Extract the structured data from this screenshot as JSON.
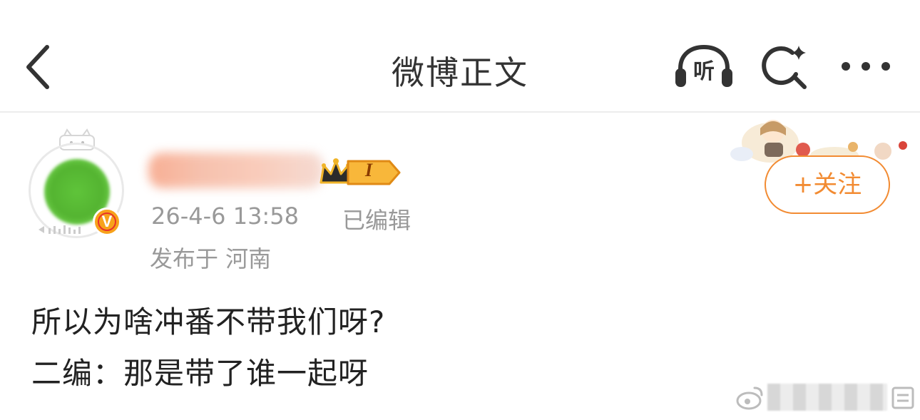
{
  "header": {
    "title": "微博正文",
    "listen_label": "听"
  },
  "author": {
    "post_time": "26-4-6 13:58",
    "edited_label": "已编辑",
    "location": "发布于 河南",
    "vip_badge": "V",
    "member_level": "I",
    "follow_label": "+关注"
  },
  "post": {
    "lines": [
      "所以为啥冲番不带我们呀?",
      "二编：那是带了谁一起呀"
    ]
  },
  "colors": {
    "accent_orange": "#f28b32",
    "meta_gray": "#999999",
    "text_dark": "#222222",
    "vip_orange": "#f7a21b"
  }
}
